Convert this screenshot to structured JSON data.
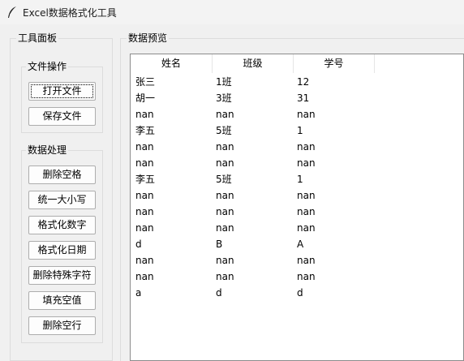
{
  "window": {
    "title": "Excel数据格式化工具",
    "icon": "feather-icon"
  },
  "left_panel": {
    "title": "工具面板",
    "file_ops": {
      "title": "文件操作",
      "buttons": [
        "打开文件",
        "保存文件"
      ]
    },
    "data_ops": {
      "title": "数据处理",
      "buttons": [
        "删除空格",
        "统一大小写",
        "格式化数字",
        "格式化日期",
        "删除特殊字符",
        "填充空值",
        "删除空行"
      ]
    }
  },
  "preview": {
    "title": "数据预览",
    "columns": [
      "姓名",
      "班级",
      "学号"
    ],
    "rows": [
      [
        "张三",
        "1班",
        "12"
      ],
      [
        "胡一",
        "3班",
        "31"
      ],
      [
        "nan",
        "nan",
        "nan"
      ],
      [
        "李五",
        "5班",
        "1"
      ],
      [
        "nan",
        "nan",
        "nan"
      ],
      [
        "nan",
        "nan",
        "nan"
      ],
      [
        "李五",
        "5班",
        "1"
      ],
      [
        "nan",
        "nan",
        "nan"
      ],
      [
        "nan",
        "nan",
        "nan"
      ],
      [
        "nan",
        "nan",
        "nan"
      ],
      [
        "d",
        "B",
        "A"
      ],
      [
        "nan",
        "nan",
        "nan"
      ],
      [
        "nan",
        "nan",
        "nan"
      ],
      [
        "a",
        "d",
        "d"
      ]
    ]
  }
}
